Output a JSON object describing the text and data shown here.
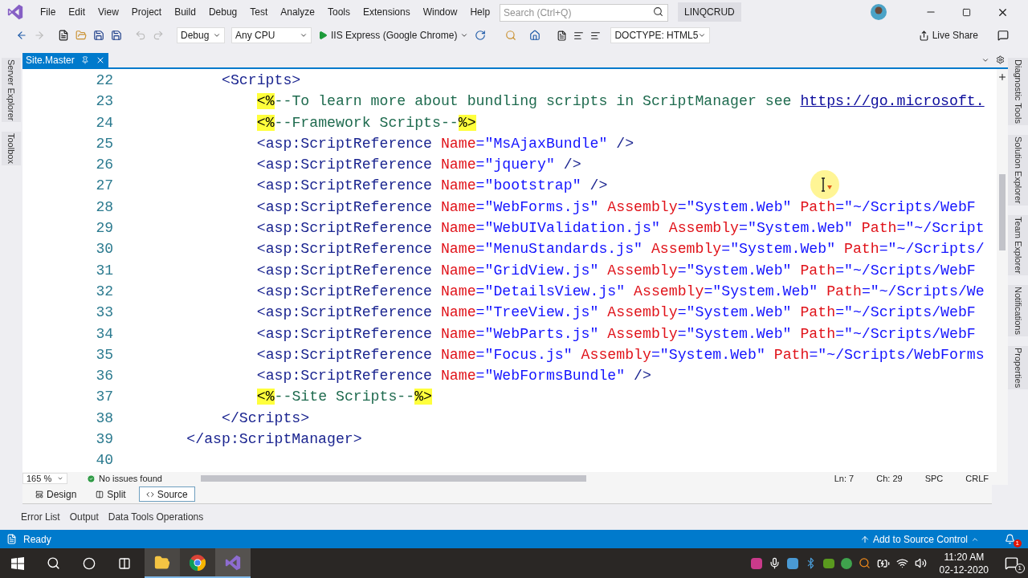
{
  "menu": [
    "File",
    "Edit",
    "View",
    "Project",
    "Build",
    "Debug",
    "Test",
    "Analyze",
    "Tools",
    "Extensions",
    "Window",
    "Help"
  ],
  "search": {
    "placeholder": "Search (Ctrl+Q)"
  },
  "solution_name": "LINQCRUD",
  "toolbar": {
    "configuration": "Debug",
    "platform": "Any CPU",
    "run_target": "IIS Express (Google Chrome)",
    "doctype": "DOCTYPE: HTML5",
    "live_share": "Live Share"
  },
  "left_panels": [
    "Server Explorer",
    "Toolbox"
  ],
  "right_panels": [
    "Diagnostic Tools",
    "Solution Explorer",
    "Team Explorer",
    "Notifications",
    "Properties"
  ],
  "doc_tabs": [
    {
      "title": "Site.Master",
      "selected": true
    }
  ],
  "code_lines": [
    {
      "children": [
        {
          "number": "22",
          "tokens": [
            {
              "kind": "tag",
              "text": "<Scripts>"
            }
          ],
          "children": [
            {
              "number": "23",
              "tokens": [
                {
                  "kind": "directive",
                  "text": "<%"
                },
                {
                  "kind": "comment",
                  "text": "--To learn more about bundling scripts in ScriptManager see "
                },
                {
                  "kind": "link",
                  "text": "https://go.microsoft."
                }
              ]
            },
            {
              "number": "24",
              "tokens": [
                {
                  "kind": "directive",
                  "text": "<%"
                },
                {
                  "kind": "comment",
                  "text": "--Framework Scripts--"
                },
                {
                  "kind": "directive",
                  "text": "%>"
                }
              ]
            },
            {
              "number": "25",
              "tokens": [
                {
                  "kind": "tag",
                  "text": "<asp:ScriptReference "
                },
                {
                  "kind": "attr",
                  "text": "Name"
                },
                {
                  "kind": "value",
                  "text": "=\"MsAjaxBundle\" "
                },
                {
                  "kind": "tag",
                  "text": "/>"
                }
              ]
            },
            {
              "number": "26",
              "tokens": [
                {
                  "kind": "tag",
                  "text": "<asp:ScriptReference "
                },
                {
                  "kind": "attr",
                  "text": "Name"
                },
                {
                  "kind": "value",
                  "text": "=\"jquery\" "
                },
                {
                  "kind": "tag",
                  "text": "/>"
                }
              ]
            },
            {
              "number": "27",
              "tokens": [
                {
                  "kind": "tag",
                  "text": "<asp:ScriptReference "
                },
                {
                  "kind": "attr",
                  "text": "Name"
                },
                {
                  "kind": "value",
                  "text": "=\"bootstrap\" "
                },
                {
                  "kind": "tag",
                  "text": "/>"
                }
              ]
            },
            {
              "number": "28",
              "tokens": [
                {
                  "kind": "tag",
                  "text": "<asp:ScriptReference "
                },
                {
                  "kind": "attr",
                  "text": "Name"
                },
                {
                  "kind": "value",
                  "text": "=\"WebForms.js\" "
                },
                {
                  "kind": "attr",
                  "text": "Assembly"
                },
                {
                  "kind": "value",
                  "text": "=\"System.Web\" "
                },
                {
                  "kind": "attr",
                  "text": "Path"
                },
                {
                  "kind": "value",
                  "text": "=\"~/Scripts/WebF"
                }
              ]
            },
            {
              "number": "29",
              "tokens": [
                {
                  "kind": "tag",
                  "text": "<asp:ScriptReference "
                },
                {
                  "kind": "attr",
                  "text": "Name"
                },
                {
                  "kind": "value",
                  "text": "=\"WebUIValidation.js\" "
                },
                {
                  "kind": "attr",
                  "text": "Assembly"
                },
                {
                  "kind": "value",
                  "text": "=\"System.Web\" "
                },
                {
                  "kind": "attr",
                  "text": "Path"
                },
                {
                  "kind": "value",
                  "text": "=\"~/Script"
                }
              ]
            },
            {
              "number": "30",
              "tokens": [
                {
                  "kind": "tag",
                  "text": "<asp:ScriptReference "
                },
                {
                  "kind": "attr",
                  "text": "Name"
                },
                {
                  "kind": "value",
                  "text": "=\"MenuStandards.js\" "
                },
                {
                  "kind": "attr",
                  "text": "Assembly"
                },
                {
                  "kind": "value",
                  "text": "=\"System.Web\" "
                },
                {
                  "kind": "attr",
                  "text": "Path"
                },
                {
                  "kind": "value",
                  "text": "=\"~/Scripts/"
                }
              ]
            },
            {
              "number": "31",
              "tokens": [
                {
                  "kind": "tag",
                  "text": "<asp:ScriptReference "
                },
                {
                  "kind": "attr",
                  "text": "Name"
                },
                {
                  "kind": "value",
                  "text": "=\"GridView.js\" "
                },
                {
                  "kind": "attr",
                  "text": "Assembly"
                },
                {
                  "kind": "value",
                  "text": "=\"System.Web\" "
                },
                {
                  "kind": "attr",
                  "text": "Path"
                },
                {
                  "kind": "value",
                  "text": "=\"~/Scripts/WebF"
                }
              ]
            },
            {
              "number": "32",
              "tokens": [
                {
                  "kind": "tag",
                  "text": "<asp:ScriptReference "
                },
                {
                  "kind": "attr",
                  "text": "Name"
                },
                {
                  "kind": "value",
                  "text": "=\"DetailsView.js\" "
                },
                {
                  "kind": "attr",
                  "text": "Assembly"
                },
                {
                  "kind": "value",
                  "text": "=\"System.Web\" "
                },
                {
                  "kind": "attr",
                  "text": "Path"
                },
                {
                  "kind": "value",
                  "text": "=\"~/Scripts/We"
                }
              ]
            },
            {
              "number": "33",
              "tokens": [
                {
                  "kind": "tag",
                  "text": "<asp:ScriptReference "
                },
                {
                  "kind": "attr",
                  "text": "Name"
                },
                {
                  "kind": "value",
                  "text": "=\"TreeView.js\" "
                },
                {
                  "kind": "attr",
                  "text": "Assembly"
                },
                {
                  "kind": "value",
                  "text": "=\"System.Web\" "
                },
                {
                  "kind": "attr",
                  "text": "Path"
                },
                {
                  "kind": "value",
                  "text": "=\"~/Scripts/WebF"
                }
              ]
            },
            {
              "number": "34",
              "tokens": [
                {
                  "kind": "tag",
                  "text": "<asp:ScriptReference "
                },
                {
                  "kind": "attr",
                  "text": "Name"
                },
                {
                  "kind": "value",
                  "text": "=\"WebParts.js\" "
                },
                {
                  "kind": "attr",
                  "text": "Assembly"
                },
                {
                  "kind": "value",
                  "text": "=\"System.Web\" "
                },
                {
                  "kind": "attr",
                  "text": "Path"
                },
                {
                  "kind": "value",
                  "text": "=\"~/Scripts/WebF"
                }
              ]
            },
            {
              "number": "35",
              "tokens": [
                {
                  "kind": "tag",
                  "text": "<asp:ScriptReference "
                },
                {
                  "kind": "attr",
                  "text": "Name"
                },
                {
                  "kind": "value",
                  "text": "=\"Focus.js\" "
                },
                {
                  "kind": "attr",
                  "text": "Assembly"
                },
                {
                  "kind": "value",
                  "text": "=\"System.Web\" "
                },
                {
                  "kind": "attr",
                  "text": "Path"
                },
                {
                  "kind": "value",
                  "text": "=\"~/Scripts/WebForms"
                }
              ]
            },
            {
              "number": "36",
              "tokens": [
                {
                  "kind": "tag",
                  "text": "<asp:ScriptReference "
                },
                {
                  "kind": "attr",
                  "text": "Name"
                },
                {
                  "kind": "value",
                  "text": "=\"WebFormsBundle\" "
                },
                {
                  "kind": "tag",
                  "text": "/>"
                }
              ]
            },
            {
              "number": "37",
              "tokens": [
                {
                  "kind": "directive",
                  "text": "<%"
                },
                {
                  "kind": "comment",
                  "text": "--Site Scripts--"
                },
                {
                  "kind": "directive",
                  "text": "%>"
                }
              ]
            }
          ]
        },
        {
          "number": "38",
          "tokens": [
            {
              "kind": "tag",
              "text": "</Scripts>"
            }
          ]
        }
      ]
    },
    {
      "number": "39",
      "tokens": [
        {
          "kind": "tag",
          "text": "</asp:ScriptManager>"
        }
      ]
    },
    {
      "number": "40"
    }
  ],
  "editor_status": {
    "zoom": "165 %",
    "issues": "No issues found",
    "line": "Ln: 7",
    "column": "Ch: 29",
    "whitespace": "SPC",
    "line_ending": "CRLF"
  },
  "view_tabs": [
    {
      "label": "Design",
      "selected": false
    },
    {
      "label": "Split",
      "selected": false
    },
    {
      "label": "Source",
      "selected": true
    }
  ],
  "tool_tabs": [
    "Error List",
    "Output",
    "Data Tools Operations"
  ],
  "status_bar": {
    "text": "Ready",
    "source_control": "Add to Source Control",
    "notification_count": "1"
  },
  "taskbar": {
    "time": "11:20 AM",
    "date": "02-12-2020",
    "action_center_count": "1"
  }
}
